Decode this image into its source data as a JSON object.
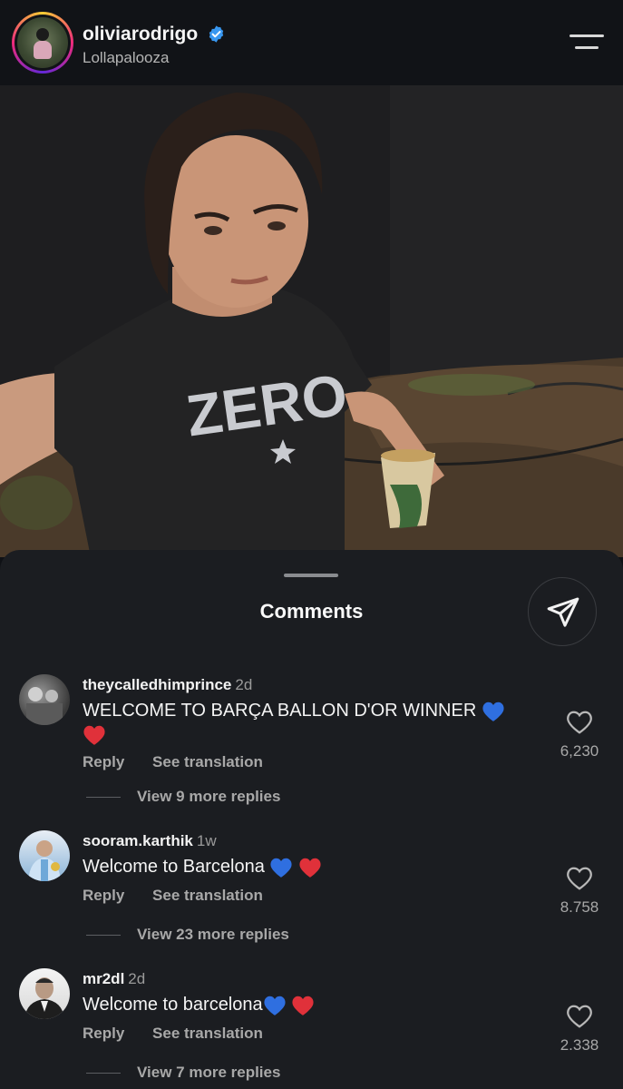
{
  "header": {
    "username": "oliviarodrigo",
    "location": "Lollapalooza",
    "verified_icon": "verified-badge-icon",
    "menu_icon": "menu-icon"
  },
  "post": {
    "shirt_text": "ZERO"
  },
  "comments_sheet": {
    "title": "Comments",
    "share_icon": "send-icon"
  },
  "comments": [
    {
      "username": "theycalledhimprince",
      "time": "2d",
      "text": "WELCOME TO BARÇA BALLON D'OR WINNER",
      "reply_label": "Reply",
      "translate_label": "See translation",
      "like_count": "6,230",
      "view_replies": "View 9 more replies"
    },
    {
      "username": "sooram.karthik",
      "time": "1w",
      "text": "Welcome to Barcelona",
      "reply_label": "Reply",
      "translate_label": "See translation",
      "like_count": "8.758",
      "view_replies": "View 23 more replies"
    },
    {
      "username": "mr2dl",
      "time": "2d",
      "text": "Welcome to barcelona",
      "reply_label": "Reply",
      "translate_label": "See translation",
      "like_count": "2.338",
      "view_replies": "View 7 more replies"
    }
  ],
  "colors": {
    "background": "#0f1115",
    "sheet": "#1b1d21",
    "verified": "#3897f0",
    "blue_heart": "#2f6fe0",
    "red_heart": "#e0313a"
  }
}
